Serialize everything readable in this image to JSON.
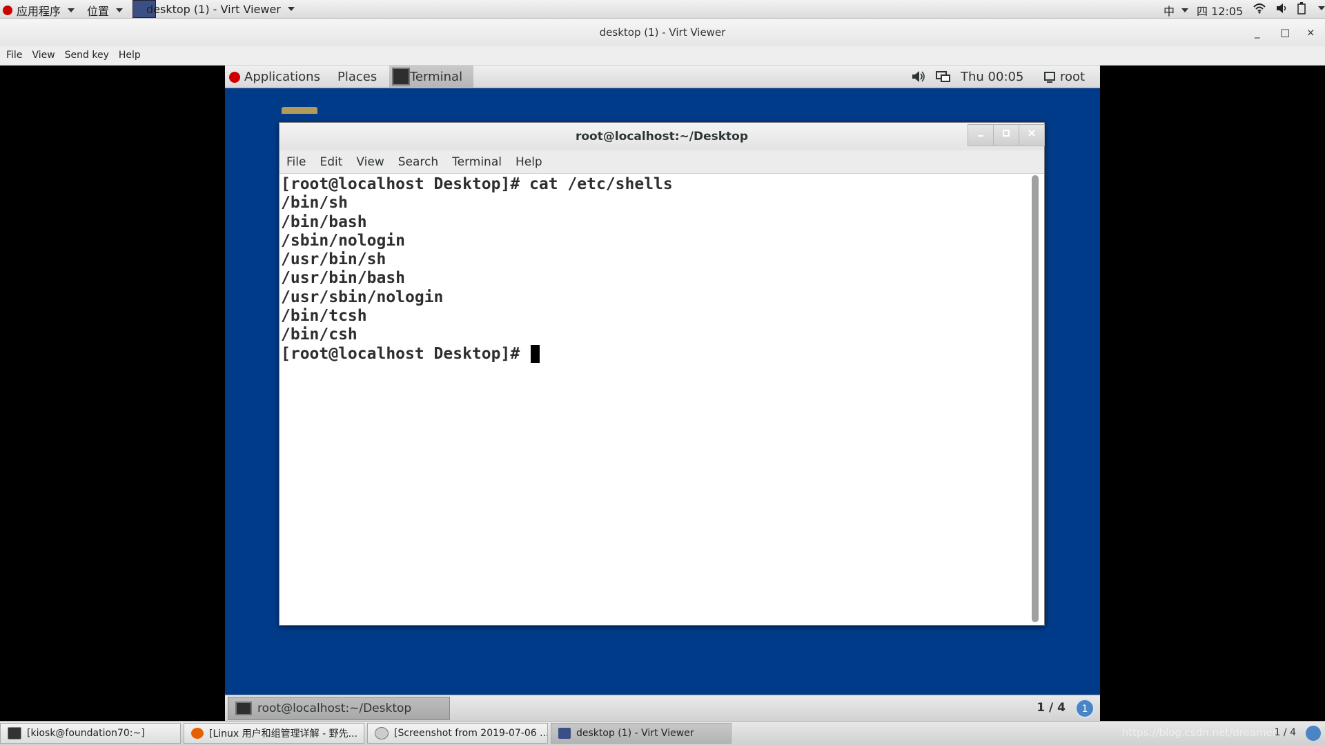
{
  "host_panel": {
    "applications": "应用程序",
    "places": "位置",
    "window": "desktop (1) - Virt Viewer",
    "ime": "中",
    "clock": "四 12:05"
  },
  "viewer": {
    "title": "desktop (1) - Virt Viewer",
    "menu": [
      "File",
      "View",
      "Send key",
      "Help"
    ],
    "minimize": "_",
    "maximize": "□",
    "close": "×"
  },
  "guest_panel": {
    "applications": "Applications",
    "places": "Places",
    "terminal": "Terminal",
    "clock": "Thu 00:05",
    "user": "root"
  },
  "terminal": {
    "title": "root@localhost:~/Desktop",
    "menu": [
      "File",
      "Edit",
      "View",
      "Search",
      "Terminal",
      "Help"
    ],
    "lines": [
      "[root@localhost Desktop]# cat /etc/shells",
      "/bin/sh",
      "/bin/bash",
      "/sbin/nologin",
      "/usr/bin/sh",
      "/usr/bin/bash",
      "/usr/sbin/nologin",
      "/bin/tcsh",
      "/bin/csh",
      "[root@localhost Desktop]# "
    ]
  },
  "guest_bottom": {
    "task": "root@localhost:~/Desktop",
    "workspace": "1 / 4",
    "notifications": "1"
  },
  "host_taskbar": {
    "tasks": [
      "[kiosk@foundation70:~]",
      "[Linux 用户和组管理详解 - 野先...",
      "[Screenshot from 2019-07-06 ...",
      "desktop (1) - Virt Viewer"
    ],
    "workspace": "1 / 4",
    "watermark": "https://blog.csdn.net/dreamer"
  },
  "colors": {
    "guest_desktop": "#003b8a",
    "redhat": "#cc0000",
    "notification": "#4a84c4"
  }
}
